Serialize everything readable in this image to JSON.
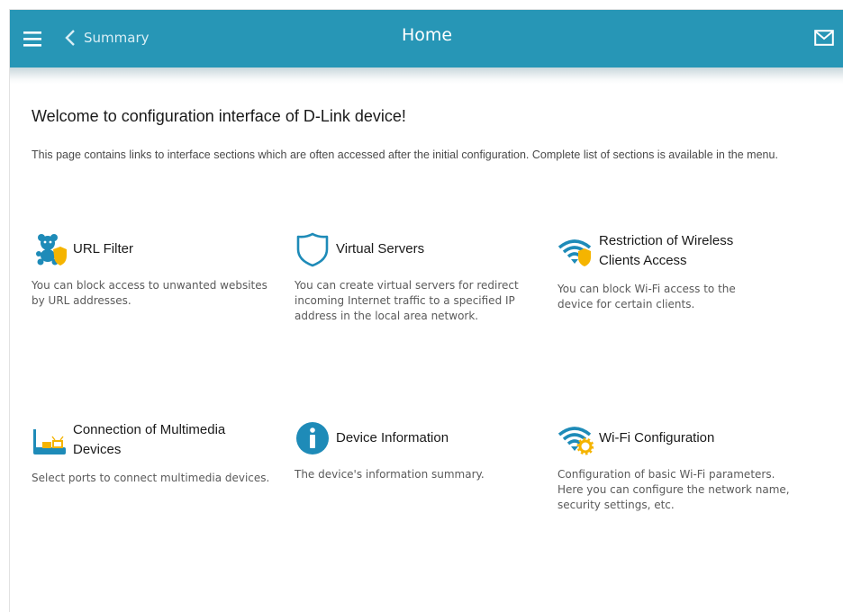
{
  "header": {
    "back_label": "Summary",
    "title": "Home"
  },
  "main": {
    "welcome": "Welcome to configuration interface of D-Link device!",
    "intro": "This page contains links to interface sections which are often accessed after the initial configuration. Complete list of sections is available in the menu."
  },
  "tiles": [
    {
      "title": "URL Filter",
      "desc": "You can block access to unwanted websites by URL addresses.",
      "icon": "url-filter-icon"
    },
    {
      "title": "Virtual Servers",
      "desc": "You can create virtual servers for redirect incoming Internet traffic to a specified IP address in the local area network.",
      "icon": "shield-icon"
    },
    {
      "title": "Restriction of Wireless Clients Access",
      "desc": "You can block Wi-Fi access to the device for certain clients.",
      "icon": "wifi-shield-icon"
    },
    {
      "title": "Connection of Multimedia Devices",
      "desc": "Select ports to connect multimedia devices.",
      "icon": "multimedia-devices-icon"
    },
    {
      "title": "Device Information",
      "desc": "The device's information summary.",
      "icon": "info-icon"
    },
    {
      "title": "Wi-Fi Configuration",
      "desc": "Configuration of basic Wi-Fi parameters. Here you can configure the network name, security settings, etc.",
      "icon": "wifi-gear-icon"
    }
  ],
  "colors": {
    "header_bg": "#2796b6",
    "icon_blue": "#1e8bb8",
    "icon_accent": "#f5b400"
  }
}
